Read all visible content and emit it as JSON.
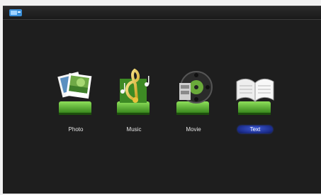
{
  "menu": {
    "items": [
      {
        "label": "Photo",
        "icon": "photo-stack-icon",
        "selected": false
      },
      {
        "label": "Music",
        "icon": "music-note-icon",
        "selected": false
      },
      {
        "label": "Movie",
        "icon": "film-reel-icon",
        "selected": false
      },
      {
        "label": "Text",
        "icon": "open-book-icon",
        "selected": true
      }
    ]
  },
  "colors": {
    "background": "#1e1e1e",
    "base_green": "#4fae2c",
    "selection": "#1b2c8a"
  }
}
